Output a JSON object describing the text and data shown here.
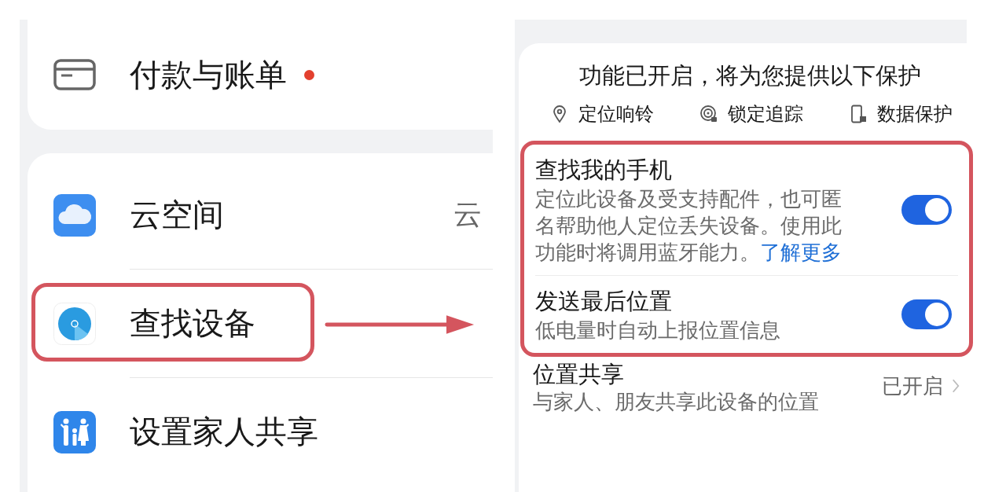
{
  "left_panel": {
    "top_card": {
      "items": [
        {
          "label": "付款与账单",
          "badge_dot": true
        }
      ]
    },
    "main_card": {
      "items": [
        {
          "label": "云空间",
          "value": "云",
          "highlighted": false
        },
        {
          "label": "查找设备",
          "highlighted": true
        },
        {
          "label": "设置家人共享",
          "highlighted": false
        }
      ]
    }
  },
  "right_panel": {
    "header": "功能已开启，将为您提供以下保护",
    "features": [
      {
        "label": "定位响铃"
      },
      {
        "label": "锁定追踪"
      },
      {
        "label": "数据保护"
      }
    ],
    "highlighted_group": {
      "highlighted": true,
      "rows": [
        {
          "title": "查找我的手机",
          "description": "定位此设备及受支持配件，也可匿名帮助他人定位丢失设备。使用此功能时将调用蓝牙能力。",
          "link": "了解更多",
          "on": true
        },
        {
          "title": "发送最后位置",
          "description": "低电量时自动上报位置信息",
          "on": true
        }
      ]
    },
    "location_sharing": {
      "title": "位置共享",
      "description": "与家人、朋友共享此设备的位置",
      "value": "已开启"
    }
  }
}
